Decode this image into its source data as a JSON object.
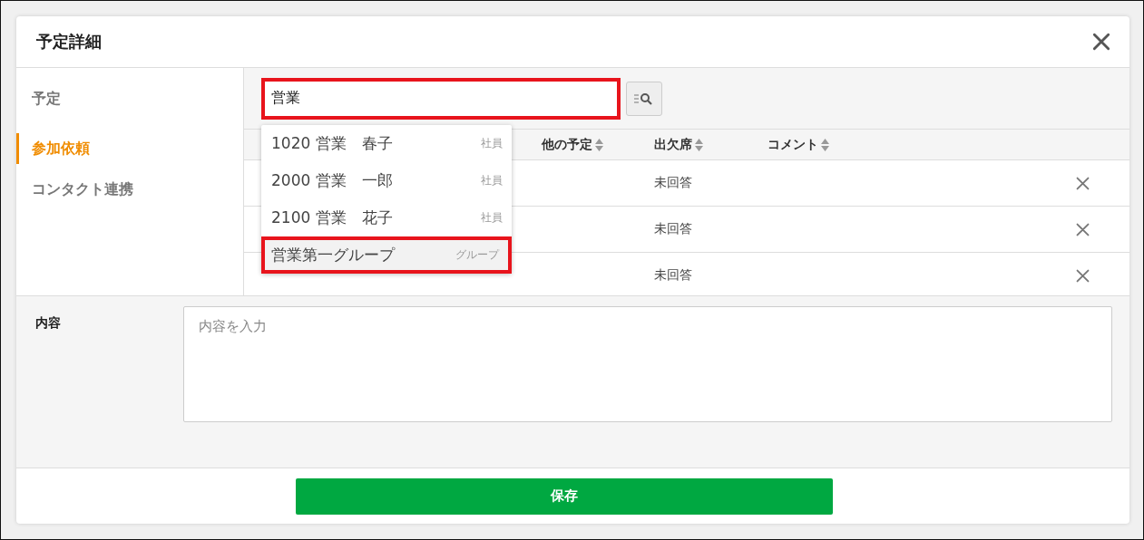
{
  "dialog": {
    "title": "予定詳細"
  },
  "sidebar": {
    "items": [
      {
        "label": "予定",
        "selected": false
      },
      {
        "label": "参加依頼",
        "selected": true
      },
      {
        "label": "コンタクト連携",
        "selected": false
      }
    ]
  },
  "search": {
    "value": "営業",
    "highlighted": true
  },
  "table": {
    "columns": [
      "他の予定",
      "出欠席",
      "コメント"
    ],
    "rows": [
      {
        "attendance": "未回答"
      },
      {
        "attendance": "未回答"
      },
      {
        "attendance": "未回答"
      }
    ]
  },
  "suggestions": [
    {
      "label": "1020 営業　春子",
      "type": "社員",
      "highlighted": false
    },
    {
      "label": "2000 営業　一郎",
      "type": "社員",
      "highlighted": false
    },
    {
      "label": "2100 営業　花子",
      "type": "社員",
      "highlighted": false
    },
    {
      "label": "営業第一グループ",
      "type": "グループ",
      "highlighted": true
    }
  ],
  "content": {
    "label": "内容",
    "placeholder": "内容を入力"
  },
  "save_button": "保存"
}
